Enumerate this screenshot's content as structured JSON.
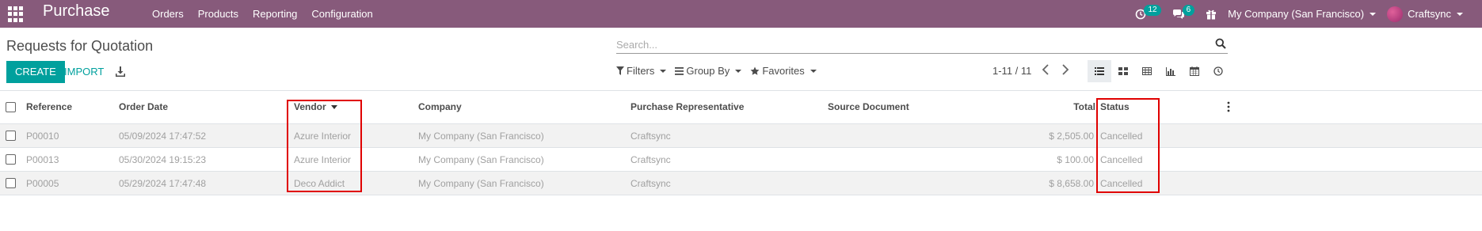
{
  "navbar": {
    "app_title": "Purchase",
    "menu": [
      "Orders",
      "Products",
      "Reporting",
      "Configuration"
    ],
    "activity_count": "12",
    "messages_count": "6",
    "company": "My Company (San Francisco)",
    "user": "Craftsync"
  },
  "control_panel": {
    "breadcrumb": "Requests for Quotation",
    "search_placeholder": "Search...",
    "create_label": "CREATE",
    "import_label": "IMPORT",
    "filters_label": "Filters",
    "group_by_label": "Group By",
    "favorites_label": "Favorites",
    "pager": "1-11 / 11"
  },
  "table": {
    "columns": {
      "reference": "Reference",
      "order_date": "Order Date",
      "vendor": "Vendor",
      "company": "Company",
      "purchase_rep": "Purchase Representative",
      "source_document": "Source Document",
      "total": "Total",
      "status": "Status"
    },
    "rows": [
      {
        "reference": "P00010",
        "order_date": "05/09/2024 17:47:52",
        "vendor": "Azure Interior",
        "company": "My Company (San Francisco)",
        "purchase_rep": "Craftsync",
        "source_document": "",
        "total": "$ 2,505.00",
        "status": "Cancelled"
      },
      {
        "reference": "P00013",
        "order_date": "05/30/2024 19:15:23",
        "vendor": "Azure Interior",
        "company": "My Company (San Francisco)",
        "purchase_rep": "Craftsync",
        "source_document": "",
        "total": "$ 100.00",
        "status": "Cancelled"
      },
      {
        "reference": "P00005",
        "order_date": "05/29/2024 17:47:48",
        "vendor": "Deco Addict",
        "company": "My Company (San Francisco)",
        "purchase_rep": "Craftsync",
        "source_document": "",
        "total": "$ 8,658.00",
        "status": "Cancelled"
      }
    ]
  },
  "colors": {
    "navbar": "#875a7b",
    "primary": "#00a09d",
    "highlight": "#e00000"
  }
}
